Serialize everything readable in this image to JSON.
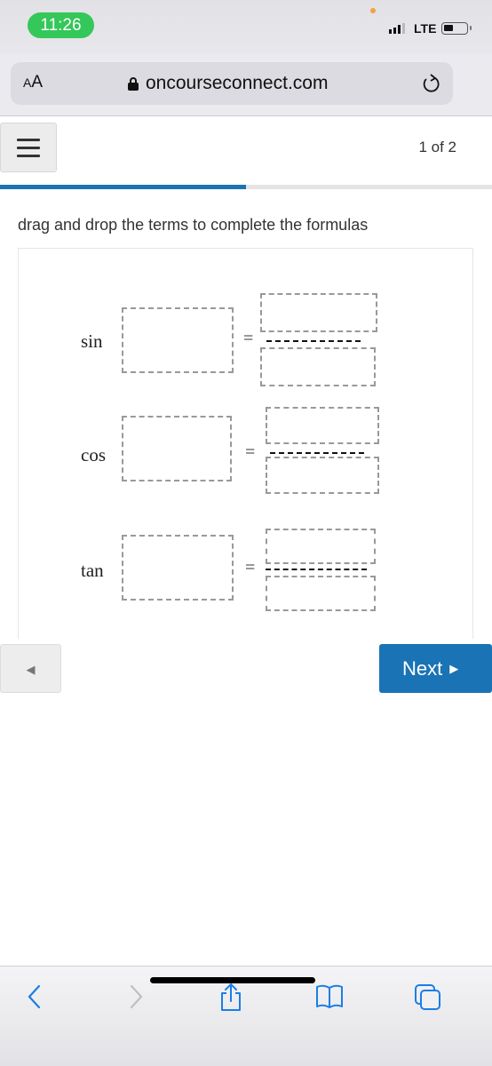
{
  "status_bar": {
    "time": "11:26",
    "network": "LTE",
    "signal_bars_active": 3,
    "signal_bars_total": 4,
    "battery_icon": "battery-icon",
    "time_pill_color": "#34c759"
  },
  "browser": {
    "text_size_label": "AA",
    "url": "oncourseconnect.com",
    "secure": true,
    "reload_icon": "reload-icon"
  },
  "header": {
    "menu_icon": "hamburger-icon",
    "page_indicator": "1 of 2",
    "progress_percent": 50,
    "accent_color": "#1a73b4"
  },
  "question": {
    "instructions": "drag and drop the terms to complete the formulas",
    "formulas": [
      {
        "function": "sin",
        "equals": "="
      },
      {
        "function": "cos",
        "equals": "="
      },
      {
        "function": "tan",
        "equals": "="
      }
    ]
  },
  "navigation": {
    "prev_icon": "◀",
    "next_label": "Next",
    "next_icon": "▶"
  },
  "browser_toolbar": {
    "back_icon": "back-icon",
    "forward_icon": "forward-icon",
    "share_icon": "share-icon",
    "bookmarks_icon": "bookmarks-icon",
    "tabs_icon": "tabs-icon"
  }
}
